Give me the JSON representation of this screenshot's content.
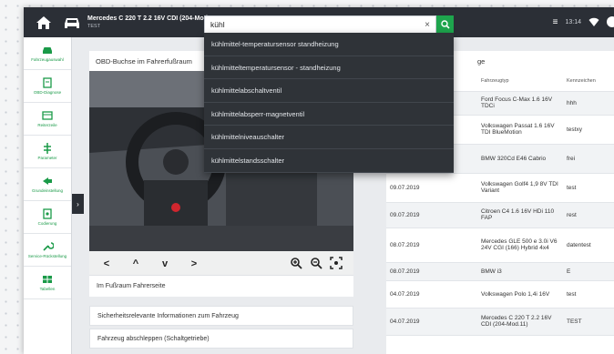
{
  "header": {
    "vehicle_title": "Mercedes C 220 T 2.2 16V CDI (204-Mod....",
    "vehicle_sub": "TEST",
    "time": "13:14"
  },
  "search": {
    "value": "kühl",
    "clear_label": "×"
  },
  "dropdown": {
    "items": [
      "kühlmittel-temperatursensor standheizung",
      "kühlmitteltemperatursensor - standheizung",
      "kühlmittelabschaltventil",
      "kühlmittelabsperr-magnetventil",
      "kühlmittelniveauschalter",
      "kühlmittelstandsschalter"
    ]
  },
  "sidebar": {
    "items": [
      {
        "label": "Fahrzeugauswahl",
        "icon": "car-icon"
      },
      {
        "label": "OBD-Diagnose",
        "icon": "diagnose-icon"
      },
      {
        "label": "Reiterzeile",
        "icon": "tab-icon"
      },
      {
        "label": "Parameter",
        "icon": "parameter-icon"
      },
      {
        "label": "Grundeinstellung",
        "icon": "settings-icon"
      },
      {
        "label": "Codierung",
        "icon": "coding-icon"
      },
      {
        "label": "Service-Rückstellung",
        "icon": "service-icon"
      },
      {
        "label": "Tabellen",
        "icon": "tables-icon"
      }
    ],
    "toggle_label": "›"
  },
  "left": {
    "heading": "OBD-Buchse im Fahrerfußraum",
    "nav_buttons": [
      "<",
      "^",
      "v",
      ">"
    ],
    "caption": "Im Fußraum Fahrerseite",
    "sections": [
      "Sicherheitsrelevante Informationen zum Fahrzeug",
      "Fahrzeug abschleppen (Schaltgetriebe)"
    ]
  },
  "right": {
    "title": "ge",
    "columns": [
      "Fahrzeugtyp",
      "Kennzeichen"
    ],
    "rows": [
      {
        "date": "",
        "vehicle": "Ford Focus C-Max 1.6 16V TDCi",
        "plate": "hhh"
      },
      {
        "date": "",
        "vehicle": "Volkswagen Passat 1.6 16V TDI BlueMotion",
        "plate": "testxy"
      },
      {
        "date": "",
        "vehicle": "BMW 320Cd E46 Cabrio",
        "plate": "frei"
      },
      {
        "date": "09.07.2019",
        "vehicle": "Volkswagen Golf4 1,9 8V TDI Variant",
        "plate": "test"
      },
      {
        "date": "09.07.2019",
        "vehicle": "Citroen C4 1.6 16V HDi 110 FAP",
        "plate": "rest"
      },
      {
        "date": "08.07.2019",
        "vehicle": "Mercedes GLE 500 e 3.0i V6 24V CGI (166) Hybrid 4x4",
        "plate": "datentest"
      },
      {
        "date": "08.07.2019",
        "vehicle": "BMW i3",
        "plate": "E"
      },
      {
        "date": "04.07.2019",
        "vehicle": "Volkswagen Polo 1,4i 16V",
        "plate": "test"
      },
      {
        "date": "04.07.2019",
        "vehicle": "Mercedes C 220 T 2.2 16V CDI (204-Mod.11)",
        "plate": "TEST"
      }
    ]
  },
  "colors": {
    "accent": "#1ea54d",
    "topbar": "#2b2f36",
    "dropdown": "#2f3338"
  }
}
